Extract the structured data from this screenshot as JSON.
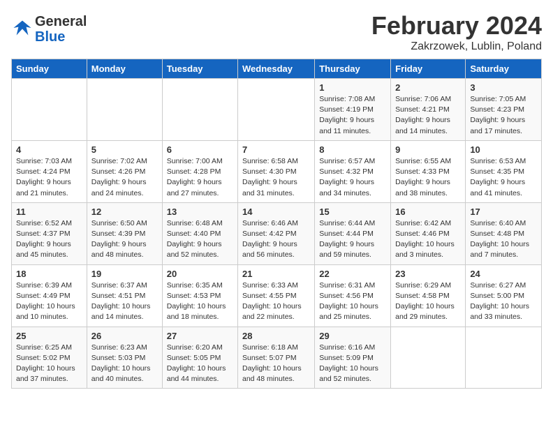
{
  "header": {
    "logo_line1": "General",
    "logo_line2": "Blue",
    "month_year": "February 2024",
    "location": "Zakrzowek, Lublin, Poland"
  },
  "weekdays": [
    "Sunday",
    "Monday",
    "Tuesday",
    "Wednesday",
    "Thursday",
    "Friday",
    "Saturday"
  ],
  "weeks": [
    [
      {
        "day": "",
        "info": ""
      },
      {
        "day": "",
        "info": ""
      },
      {
        "day": "",
        "info": ""
      },
      {
        "day": "",
        "info": ""
      },
      {
        "day": "1",
        "info": "Sunrise: 7:08 AM\nSunset: 4:19 PM\nDaylight: 9 hours\nand 11 minutes."
      },
      {
        "day": "2",
        "info": "Sunrise: 7:06 AM\nSunset: 4:21 PM\nDaylight: 9 hours\nand 14 minutes."
      },
      {
        "day": "3",
        "info": "Sunrise: 7:05 AM\nSunset: 4:23 PM\nDaylight: 9 hours\nand 17 minutes."
      }
    ],
    [
      {
        "day": "4",
        "info": "Sunrise: 7:03 AM\nSunset: 4:24 PM\nDaylight: 9 hours\nand 21 minutes."
      },
      {
        "day": "5",
        "info": "Sunrise: 7:02 AM\nSunset: 4:26 PM\nDaylight: 9 hours\nand 24 minutes."
      },
      {
        "day": "6",
        "info": "Sunrise: 7:00 AM\nSunset: 4:28 PM\nDaylight: 9 hours\nand 27 minutes."
      },
      {
        "day": "7",
        "info": "Sunrise: 6:58 AM\nSunset: 4:30 PM\nDaylight: 9 hours\nand 31 minutes."
      },
      {
        "day": "8",
        "info": "Sunrise: 6:57 AM\nSunset: 4:32 PM\nDaylight: 9 hours\nand 34 minutes."
      },
      {
        "day": "9",
        "info": "Sunrise: 6:55 AM\nSunset: 4:33 PM\nDaylight: 9 hours\nand 38 minutes."
      },
      {
        "day": "10",
        "info": "Sunrise: 6:53 AM\nSunset: 4:35 PM\nDaylight: 9 hours\nand 41 minutes."
      }
    ],
    [
      {
        "day": "11",
        "info": "Sunrise: 6:52 AM\nSunset: 4:37 PM\nDaylight: 9 hours\nand 45 minutes."
      },
      {
        "day": "12",
        "info": "Sunrise: 6:50 AM\nSunset: 4:39 PM\nDaylight: 9 hours\nand 48 minutes."
      },
      {
        "day": "13",
        "info": "Sunrise: 6:48 AM\nSunset: 4:40 PM\nDaylight: 9 hours\nand 52 minutes."
      },
      {
        "day": "14",
        "info": "Sunrise: 6:46 AM\nSunset: 4:42 PM\nDaylight: 9 hours\nand 56 minutes."
      },
      {
        "day": "15",
        "info": "Sunrise: 6:44 AM\nSunset: 4:44 PM\nDaylight: 9 hours\nand 59 minutes."
      },
      {
        "day": "16",
        "info": "Sunrise: 6:42 AM\nSunset: 4:46 PM\nDaylight: 10 hours\nand 3 minutes."
      },
      {
        "day": "17",
        "info": "Sunrise: 6:40 AM\nSunset: 4:48 PM\nDaylight: 10 hours\nand 7 minutes."
      }
    ],
    [
      {
        "day": "18",
        "info": "Sunrise: 6:39 AM\nSunset: 4:49 PM\nDaylight: 10 hours\nand 10 minutes."
      },
      {
        "day": "19",
        "info": "Sunrise: 6:37 AM\nSunset: 4:51 PM\nDaylight: 10 hours\nand 14 minutes."
      },
      {
        "day": "20",
        "info": "Sunrise: 6:35 AM\nSunset: 4:53 PM\nDaylight: 10 hours\nand 18 minutes."
      },
      {
        "day": "21",
        "info": "Sunrise: 6:33 AM\nSunset: 4:55 PM\nDaylight: 10 hours\nand 22 minutes."
      },
      {
        "day": "22",
        "info": "Sunrise: 6:31 AM\nSunset: 4:56 PM\nDaylight: 10 hours\nand 25 minutes."
      },
      {
        "day": "23",
        "info": "Sunrise: 6:29 AM\nSunset: 4:58 PM\nDaylight: 10 hours\nand 29 minutes."
      },
      {
        "day": "24",
        "info": "Sunrise: 6:27 AM\nSunset: 5:00 PM\nDaylight: 10 hours\nand 33 minutes."
      }
    ],
    [
      {
        "day": "25",
        "info": "Sunrise: 6:25 AM\nSunset: 5:02 PM\nDaylight: 10 hours\nand 37 minutes."
      },
      {
        "day": "26",
        "info": "Sunrise: 6:23 AM\nSunset: 5:03 PM\nDaylight: 10 hours\nand 40 minutes."
      },
      {
        "day": "27",
        "info": "Sunrise: 6:20 AM\nSunset: 5:05 PM\nDaylight: 10 hours\nand 44 minutes."
      },
      {
        "day": "28",
        "info": "Sunrise: 6:18 AM\nSunset: 5:07 PM\nDaylight: 10 hours\nand 48 minutes."
      },
      {
        "day": "29",
        "info": "Sunrise: 6:16 AM\nSunset: 5:09 PM\nDaylight: 10 hours\nand 52 minutes."
      },
      {
        "day": "",
        "info": ""
      },
      {
        "day": "",
        "info": ""
      }
    ]
  ]
}
